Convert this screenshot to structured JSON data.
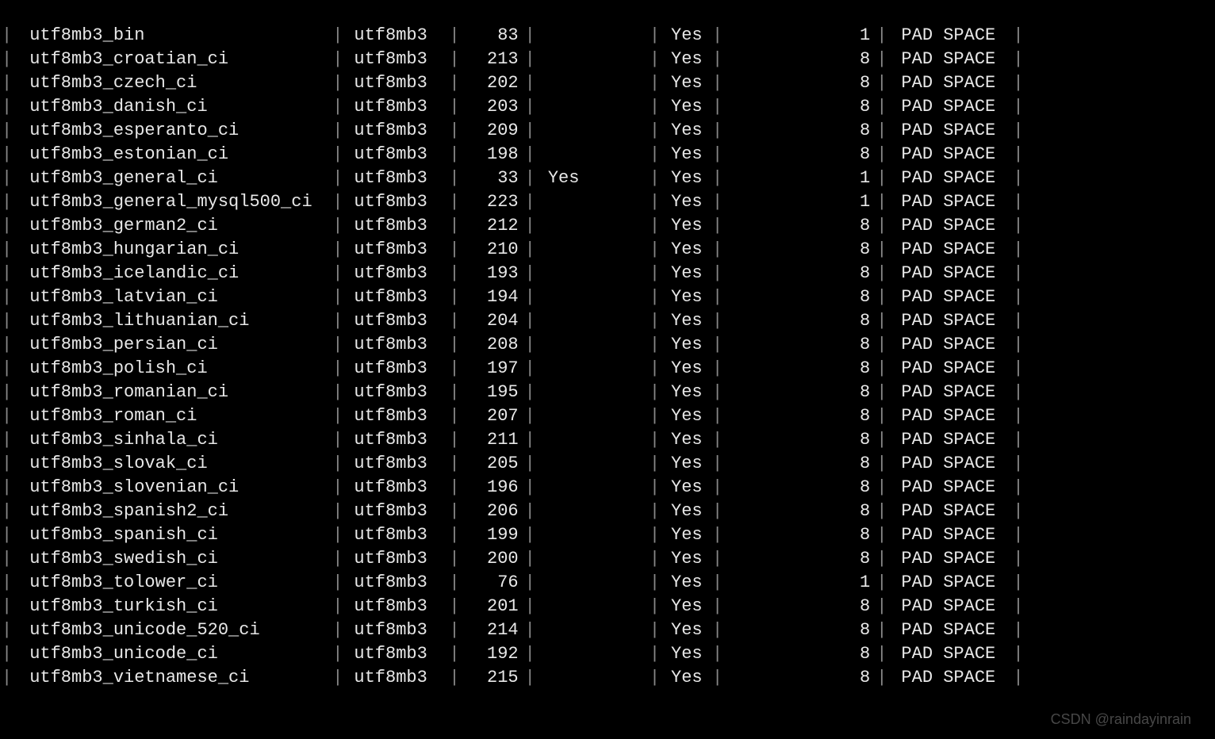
{
  "separator": "|",
  "watermark": "CSDN @raindayinrain",
  "rows": [
    {
      "collation": "utf8mb3_bin",
      "charset": "utf8mb3",
      "id": "83",
      "isdefault": "",
      "compiled": "Yes",
      "sortlen": "1",
      "pad": "PAD SPACE"
    },
    {
      "collation": "utf8mb3_croatian_ci",
      "charset": "utf8mb3",
      "id": "213",
      "isdefault": "",
      "compiled": "Yes",
      "sortlen": "8",
      "pad": "PAD SPACE"
    },
    {
      "collation": "utf8mb3_czech_ci",
      "charset": "utf8mb3",
      "id": "202",
      "isdefault": "",
      "compiled": "Yes",
      "sortlen": "8",
      "pad": "PAD SPACE"
    },
    {
      "collation": "utf8mb3_danish_ci",
      "charset": "utf8mb3",
      "id": "203",
      "isdefault": "",
      "compiled": "Yes",
      "sortlen": "8",
      "pad": "PAD SPACE"
    },
    {
      "collation": "utf8mb3_esperanto_ci",
      "charset": "utf8mb3",
      "id": "209",
      "isdefault": "",
      "compiled": "Yes",
      "sortlen": "8",
      "pad": "PAD SPACE"
    },
    {
      "collation": "utf8mb3_estonian_ci",
      "charset": "utf8mb3",
      "id": "198",
      "isdefault": "",
      "compiled": "Yes",
      "sortlen": "8",
      "pad": "PAD SPACE"
    },
    {
      "collation": "utf8mb3_general_ci",
      "charset": "utf8mb3",
      "id": "33",
      "isdefault": "Yes",
      "compiled": "Yes",
      "sortlen": "1",
      "pad": "PAD SPACE"
    },
    {
      "collation": "utf8mb3_general_mysql500_ci",
      "charset": "utf8mb3",
      "id": "223",
      "isdefault": "",
      "compiled": "Yes",
      "sortlen": "1",
      "pad": "PAD SPACE"
    },
    {
      "collation": "utf8mb3_german2_ci",
      "charset": "utf8mb3",
      "id": "212",
      "isdefault": "",
      "compiled": "Yes",
      "sortlen": "8",
      "pad": "PAD SPACE"
    },
    {
      "collation": "utf8mb3_hungarian_ci",
      "charset": "utf8mb3",
      "id": "210",
      "isdefault": "",
      "compiled": "Yes",
      "sortlen": "8",
      "pad": "PAD SPACE"
    },
    {
      "collation": "utf8mb3_icelandic_ci",
      "charset": "utf8mb3",
      "id": "193",
      "isdefault": "",
      "compiled": "Yes",
      "sortlen": "8",
      "pad": "PAD SPACE"
    },
    {
      "collation": "utf8mb3_latvian_ci",
      "charset": "utf8mb3",
      "id": "194",
      "isdefault": "",
      "compiled": "Yes",
      "sortlen": "8",
      "pad": "PAD SPACE"
    },
    {
      "collation": "utf8mb3_lithuanian_ci",
      "charset": "utf8mb3",
      "id": "204",
      "isdefault": "",
      "compiled": "Yes",
      "sortlen": "8",
      "pad": "PAD SPACE"
    },
    {
      "collation": "utf8mb3_persian_ci",
      "charset": "utf8mb3",
      "id": "208",
      "isdefault": "",
      "compiled": "Yes",
      "sortlen": "8",
      "pad": "PAD SPACE"
    },
    {
      "collation": "utf8mb3_polish_ci",
      "charset": "utf8mb3",
      "id": "197",
      "isdefault": "",
      "compiled": "Yes",
      "sortlen": "8",
      "pad": "PAD SPACE"
    },
    {
      "collation": "utf8mb3_romanian_ci",
      "charset": "utf8mb3",
      "id": "195",
      "isdefault": "",
      "compiled": "Yes",
      "sortlen": "8",
      "pad": "PAD SPACE"
    },
    {
      "collation": "utf8mb3_roman_ci",
      "charset": "utf8mb3",
      "id": "207",
      "isdefault": "",
      "compiled": "Yes",
      "sortlen": "8",
      "pad": "PAD SPACE"
    },
    {
      "collation": "utf8mb3_sinhala_ci",
      "charset": "utf8mb3",
      "id": "211",
      "isdefault": "",
      "compiled": "Yes",
      "sortlen": "8",
      "pad": "PAD SPACE"
    },
    {
      "collation": "utf8mb3_slovak_ci",
      "charset": "utf8mb3",
      "id": "205",
      "isdefault": "",
      "compiled": "Yes",
      "sortlen": "8",
      "pad": "PAD SPACE"
    },
    {
      "collation": "utf8mb3_slovenian_ci",
      "charset": "utf8mb3",
      "id": "196",
      "isdefault": "",
      "compiled": "Yes",
      "sortlen": "8",
      "pad": "PAD SPACE"
    },
    {
      "collation": "utf8mb3_spanish2_ci",
      "charset": "utf8mb3",
      "id": "206",
      "isdefault": "",
      "compiled": "Yes",
      "sortlen": "8",
      "pad": "PAD SPACE"
    },
    {
      "collation": "utf8mb3_spanish_ci",
      "charset": "utf8mb3",
      "id": "199",
      "isdefault": "",
      "compiled": "Yes",
      "sortlen": "8",
      "pad": "PAD SPACE"
    },
    {
      "collation": "utf8mb3_swedish_ci",
      "charset": "utf8mb3",
      "id": "200",
      "isdefault": "",
      "compiled": "Yes",
      "sortlen": "8",
      "pad": "PAD SPACE"
    },
    {
      "collation": "utf8mb3_tolower_ci",
      "charset": "utf8mb3",
      "id": "76",
      "isdefault": "",
      "compiled": "Yes",
      "sortlen": "1",
      "pad": "PAD SPACE"
    },
    {
      "collation": "utf8mb3_turkish_ci",
      "charset": "utf8mb3",
      "id": "201",
      "isdefault": "",
      "compiled": "Yes",
      "sortlen": "8",
      "pad": "PAD SPACE"
    },
    {
      "collation": "utf8mb3_unicode_520_ci",
      "charset": "utf8mb3",
      "id": "214",
      "isdefault": "",
      "compiled": "Yes",
      "sortlen": "8",
      "pad": "PAD SPACE"
    },
    {
      "collation": "utf8mb3_unicode_ci",
      "charset": "utf8mb3",
      "id": "192",
      "isdefault": "",
      "compiled": "Yes",
      "sortlen": "8",
      "pad": "PAD SPACE"
    },
    {
      "collation": "utf8mb3_vietnamese_ci",
      "charset": "utf8mb3",
      "id": "215",
      "isdefault": "",
      "compiled": "Yes",
      "sortlen": "8",
      "pad": "PAD SPACE"
    }
  ]
}
